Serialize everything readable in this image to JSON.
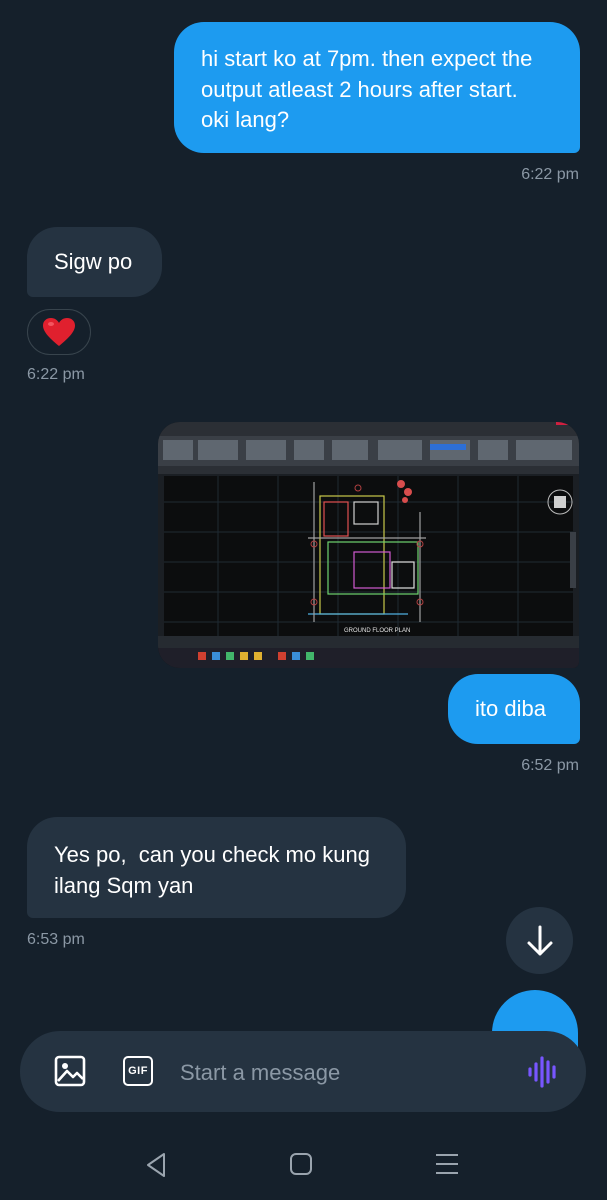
{
  "messages": [
    {
      "id": "m1",
      "direction": "sent",
      "lines": [
        "hi start ko at 7pm. then expect the",
        "output atleast 2 hours after start.",
        "oki lang?"
      ],
      "time": "6:22 pm"
    },
    {
      "id": "m2",
      "direction": "received",
      "lines": [
        "Sigw po"
      ],
      "reaction": "heart",
      "time": "6:22 pm"
    },
    {
      "id": "m3",
      "direction": "sent",
      "type": "image",
      "image_caption": "GROUND FLOOR PLAN"
    },
    {
      "id": "m4",
      "direction": "sent",
      "lines": [
        "ito diba"
      ],
      "time": "6:52 pm"
    },
    {
      "id": "m5",
      "direction": "received",
      "lines": [
        "Yes po,  can you check mo kung",
        "ilang Sqm yan"
      ],
      "time": "6:53 pm"
    }
  ],
  "composer": {
    "placeholder": "Start a message",
    "gif_label": "GIF",
    "icons": [
      "image-icon",
      "gif-icon",
      "voice-icon"
    ]
  },
  "scroll_down_icon": "arrow-down-icon",
  "nav": {
    "icons": [
      "back-icon",
      "home-icon",
      "recents-icon"
    ]
  },
  "colors": {
    "background": "#15202b",
    "sent_bubble": "#1d9bf0",
    "received_bubble": "#253341",
    "timestamp": "#8b98a5",
    "accent_voice": "#7856ff"
  }
}
